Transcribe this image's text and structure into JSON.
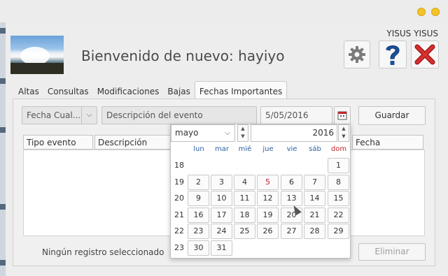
{
  "header": {
    "welcome_text": "Bienvenido de nuevo: hayiyo",
    "username": "YISUS YISUS"
  },
  "icons": {
    "settings": "gear-icon",
    "help": "question-icon",
    "exit": "red-x-icon"
  },
  "tabs": [
    {
      "label": "Altas",
      "active": false
    },
    {
      "label": "Consultas",
      "active": false
    },
    {
      "label": "Modificaciones",
      "active": false
    },
    {
      "label": "Bajas",
      "active": false
    },
    {
      "label": "Fechas Importantes",
      "active": true
    }
  ],
  "form": {
    "type_select_value": "Fecha Cual...",
    "description_placeholder": "Descripción del evento",
    "date_value": "5/05/2016",
    "save_label": "Guardar"
  },
  "table": {
    "columns": [
      "Tipo evento",
      "Descripción",
      "Fecha"
    ]
  },
  "footer": {
    "status": "Ningún registro seleccionado",
    "delete_label": "Eliminar"
  },
  "calendar": {
    "month": "mayo",
    "year": "2016",
    "weekdays": [
      "lun",
      "mar",
      "mié",
      "jue",
      "vie",
      "sáb",
      "dom"
    ],
    "weeks": [
      {
        "num": "18",
        "days": [
          "",
          "",
          "",
          "",
          "",
          "",
          "1"
        ]
      },
      {
        "num": "19",
        "days": [
          "2",
          "3",
          "4",
          "5",
          "6",
          "7",
          "8"
        ]
      },
      {
        "num": "20",
        "days": [
          "9",
          "10",
          "11",
          "12",
          "13",
          "14",
          "15"
        ]
      },
      {
        "num": "21",
        "days": [
          "16",
          "17",
          "18",
          "19",
          "20",
          "21",
          "22"
        ]
      },
      {
        "num": "22",
        "days": [
          "23",
          "24",
          "25",
          "26",
          "27",
          "28",
          "29"
        ]
      },
      {
        "num": "23",
        "days": [
          "30",
          "31",
          "",
          "",
          "",
          "",
          ""
        ]
      }
    ],
    "highlight_day": "5",
    "highlight_color": "#c0272d"
  }
}
